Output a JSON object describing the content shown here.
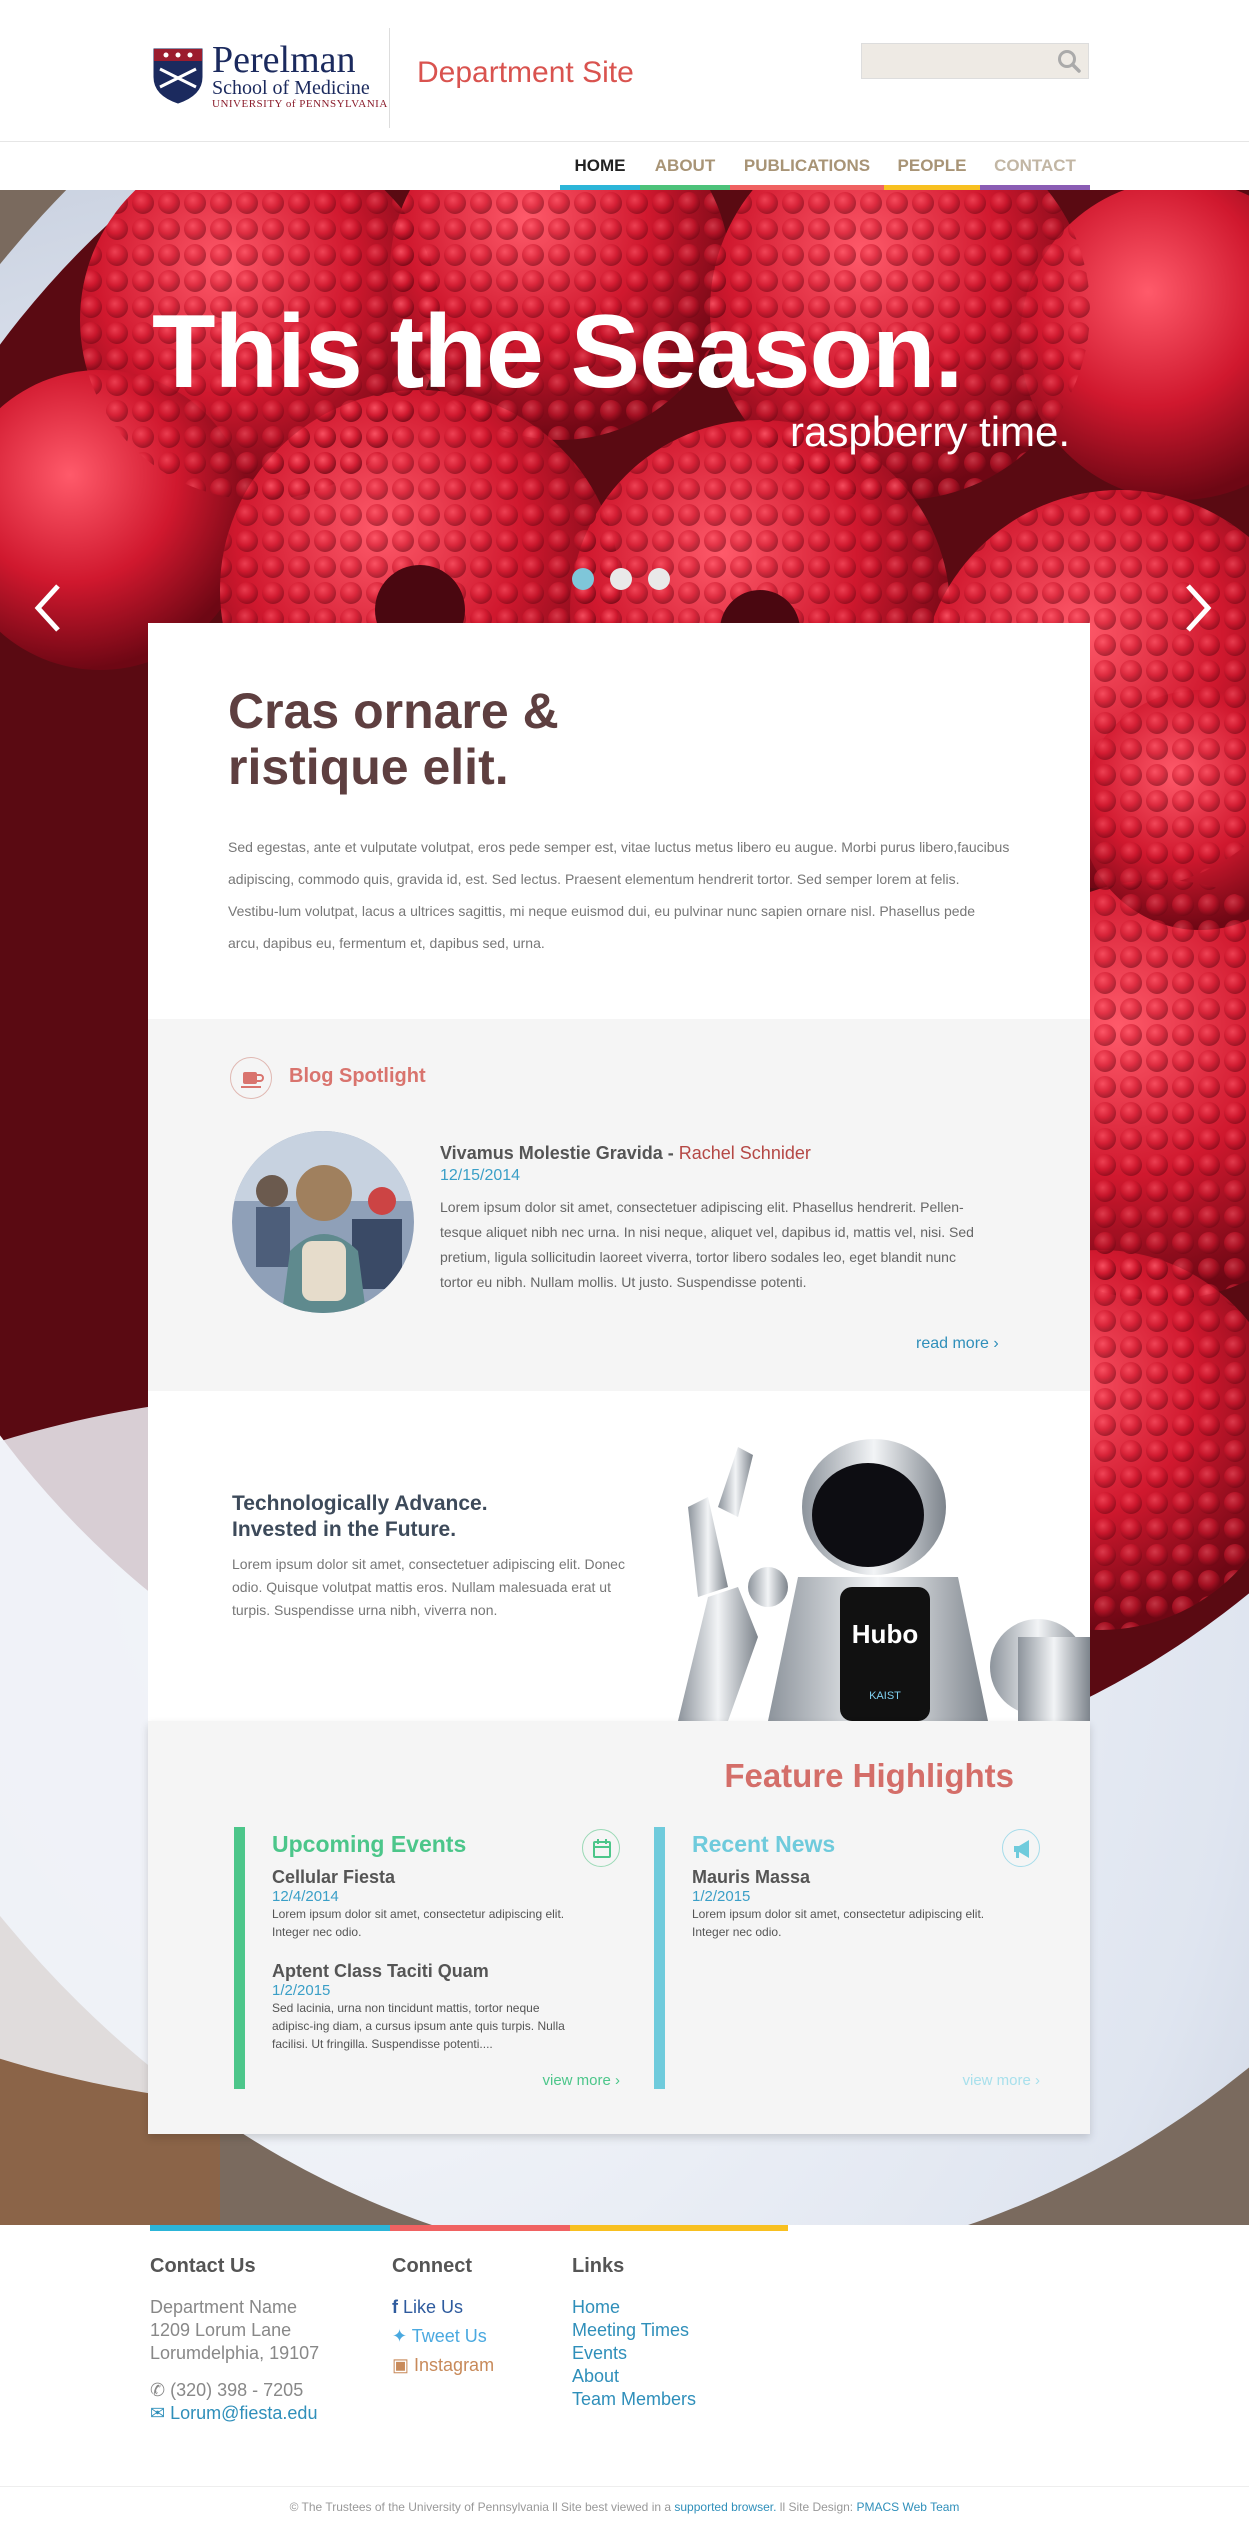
{
  "brand": {
    "logo_name": "Perelman",
    "logo_sub": "School of Medicine",
    "logo_univ": "UNIVERSITY of PENNSYLVANIA",
    "dept_title": "Department Site"
  },
  "search": {
    "placeholder": ""
  },
  "nav": [
    {
      "label": "HOME",
      "color": "#2cb5d8",
      "active": true
    },
    {
      "label": "ABOUT",
      "color": "#4cc27a"
    },
    {
      "label": "PUBLICATIONS",
      "color": "#f06262"
    },
    {
      "label": "PEOPLE",
      "color": "#f8c020"
    },
    {
      "label": "CONTACT",
      "color": "#8a5cb4"
    }
  ],
  "hero": {
    "headline": "This the Season.",
    "subline": "raspberry time.",
    "slide_count": 3,
    "active_slide": 1
  },
  "intro": {
    "title": "Cras ornare & ristique elit.",
    "body": "Sed egestas, ante et vulputate volutpat, eros pede semper est, vitae luctus metus libero eu augue. Morbi purus libero,faucibus adipiscing, commodo quis, gravida id, est. Sed lectus. Praesent elementum hendrerit tortor. Sed semper lorem at felis. Vestibu-lum volutpat, lacus a ultrices sagittis, mi neque euismod dui, eu pulvinar nunc sapien ornare nisl. Phasellus pede arcu, dapibus eu, fermentum et, dapibus sed, urna."
  },
  "blog": {
    "section_title": "Blog Spotlight",
    "post_title": "Vivamus Molestie Gravida - ",
    "author": "Rachel Schnider",
    "date": "12/15/2014",
    "body": "Lorem ipsum dolor sit amet, consectetuer adipiscing elit. Phasellus hendrerit. Pellen-tesque aliquet nibh nec urna. In nisi neque, aliquet vel, dapibus id, mattis vel, nisi. Sed pretium, ligula sollicitudin laoreet viverra, tortor libero sodales leo, eget blandit nunc tortor eu nibh. Nullam mollis. Ut justo. Suspendisse potenti.",
    "read_more": "read more ›"
  },
  "tech": {
    "title_line1": "Technologically Advance.",
    "title_line2": "Invested in the Future.",
    "body": "Lorem ipsum dolor sit amet, consectetuer adipiscing elit. Donec odio. Quisque volutpat mattis eros. Nullam malesuada erat ut turpis. Suspendisse urna nibh, viverra non.",
    "robot_label": "Hubo",
    "robot_badge": "KAIST"
  },
  "features": {
    "title": "Feature Highlights",
    "events": {
      "heading": "Upcoming Events",
      "items": [
        {
          "title": "Cellular Fiesta",
          "date": "12/4/2014",
          "body": "Lorem ipsum dolor sit amet, consectetur adipiscing elit. Integer nec odio."
        },
        {
          "title": "Aptent Class Taciti Quam",
          "date": "1/2/2015",
          "body": "Sed lacinia, urna non tincidunt mattis, tortor neque adipisc-ing diam, a cursus ipsum ante quis turpis. Nulla facilisi. Ut fringilla. Suspendisse potenti...."
        }
      ],
      "more": "view more ›"
    },
    "news": {
      "heading": "Recent News",
      "items": [
        {
          "title": "Mauris Massa",
          "date": "1/2/2015",
          "body": "Lorem ipsum dolor sit amet, consectetur adipiscing elit. Integer nec odio."
        }
      ],
      "more": "view more ›"
    }
  },
  "footer": {
    "contact": {
      "heading": "Contact Us",
      "line1": "Department Name",
      "line2": "1209 Lorum Lane",
      "line3": "Lorumdelphia, 19107",
      "phone": "(320) 398 - 7205",
      "email": "Lorum@fiesta.edu"
    },
    "connect": {
      "heading": "Connect",
      "facebook": "Like Us",
      "twitter": "Tweet Us",
      "instagram": "Instagram"
    },
    "links": {
      "heading": "Links",
      "items": [
        "Home",
        "Meeting Times",
        "Events",
        "About",
        "Team Members"
      ]
    },
    "copyright_pre": "© The Trustees of the University of Pennsylvania ll Site best viewed in a ",
    "copyright_link": "supported browser.",
    "copyright_mid": " ll Site Design: ",
    "copyright_design": "PMACS Web Team"
  }
}
